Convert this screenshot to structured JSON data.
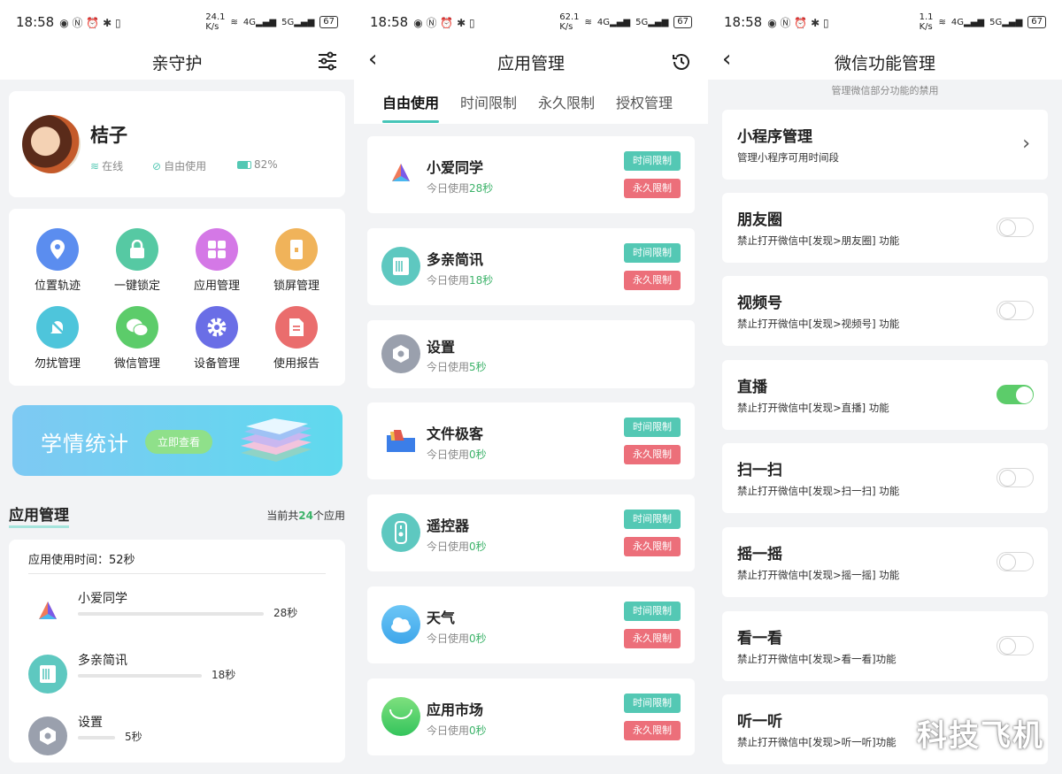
{
  "status": {
    "time": "18:58",
    "speed1": "24.1",
    "speed2": "62.1",
    "speed3": "1.1",
    "unit": "K/s",
    "battery": "67"
  },
  "panel1": {
    "title": "亲守护",
    "profile": {
      "name": "桔子",
      "online": "在线",
      "mode": "自由使用",
      "battery": "82%"
    },
    "grid": [
      {
        "label": "位置轨迹",
        "color": "#5b8def",
        "icon": "location-icon"
      },
      {
        "label": "一键锁定",
        "color": "#56c9a3",
        "icon": "lock-icon"
      },
      {
        "label": "应用管理",
        "color": "#d478e6",
        "icon": "apps-icon"
      },
      {
        "label": "锁屏管理",
        "color": "#f0b35a",
        "icon": "lockscreen-icon"
      },
      {
        "label": "勿扰管理",
        "color": "#4ec5db",
        "icon": "bell-off-icon"
      },
      {
        "label": "微信管理",
        "color": "#5ccc6a",
        "icon": "wechat-icon"
      },
      {
        "label": "设备管理",
        "color": "#6a6ee6",
        "icon": "gear-icon"
      },
      {
        "label": "使用报告",
        "color": "#ea6d6d",
        "icon": "report-icon"
      }
    ],
    "banner": {
      "title": "学情统计",
      "button": "立即查看"
    },
    "section": {
      "title": "应用管理",
      "count_pre": "当前共",
      "count": "24",
      "count_post": "个应用"
    },
    "usage": {
      "title": "应用使用时间：52秒",
      "items": [
        {
          "name": "小爱同学",
          "time": "28秒"
        },
        {
          "name": "多亲简讯",
          "time": "18秒"
        },
        {
          "name": "设置",
          "time": "5秒"
        }
      ]
    }
  },
  "panel2": {
    "title": "应用管理",
    "tabs": [
      "自由使用",
      "时间限制",
      "永久限制",
      "授权管理"
    ],
    "time_tag": "时间限制",
    "perm_tag": "永久限制",
    "today": "今日使用",
    "apps": [
      {
        "name": "小爱同学",
        "time": "28秒"
      },
      {
        "name": "多亲简讯",
        "time": "18秒"
      },
      {
        "name": "设置",
        "time": "5秒"
      },
      {
        "name": "文件极客",
        "time": "0秒"
      },
      {
        "name": "遥控器",
        "time": "0秒"
      },
      {
        "name": "天气",
        "time": "0秒"
      },
      {
        "name": "应用市场",
        "time": "0秒"
      }
    ]
  },
  "panel3": {
    "title": "微信功能管理",
    "hint": "管理微信部分功能的禁用",
    "items": [
      {
        "title": "小程序管理",
        "desc": "管理小程序可用时间段"
      },
      {
        "title": "朋友圈",
        "desc": "禁止打开微信中[发现>朋友圈] 功能"
      },
      {
        "title": "视频号",
        "desc": "禁止打开微信中[发现>视频号] 功能"
      },
      {
        "title": "直播",
        "desc": "禁止打开微信中[发现>直播] 功能"
      },
      {
        "title": "扫一扫",
        "desc": "禁止打开微信中[发现>扫一扫] 功能"
      },
      {
        "title": "摇一摇",
        "desc": "禁止打开微信中[发现>摇一摇] 功能"
      },
      {
        "title": "看一看",
        "desc": "禁止打开微信中[发现>看一看]功能"
      },
      {
        "title": "听一听",
        "desc": "禁止打开微信中[发现>听一听]功能"
      }
    ],
    "watermark": "科技飞机"
  }
}
